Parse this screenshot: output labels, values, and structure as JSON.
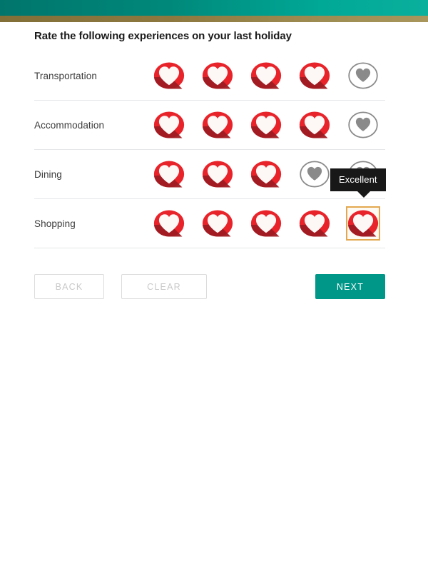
{
  "header": {
    "top_bar_color": "#00897b",
    "accent_stripe_color": "#8d7940"
  },
  "survey": {
    "title": "Rate the following experiences on your last holiday",
    "max_rating": 5,
    "selected_color": "#e8232a",
    "unselected_color": "#8a8a8a",
    "rows": [
      {
        "label": "Transportation",
        "rating": 4
      },
      {
        "label": "Accommodation",
        "rating": 4
      },
      {
        "label": "Dining",
        "rating": 3
      },
      {
        "label": "Shopping",
        "rating": 5
      }
    ],
    "focused_row_index": 3,
    "focused_icon_index": 4,
    "focus_outline_color": "#e3a84f"
  },
  "tooltip": {
    "text": "Excellent",
    "background": "#181818",
    "text_color": "#ffffff"
  },
  "buttons": {
    "back": {
      "label": "BACK",
      "disabled": true
    },
    "clear": {
      "label": "CLEAR",
      "disabled": true
    },
    "next": {
      "label": "NEXT",
      "color": "#009688"
    }
  }
}
